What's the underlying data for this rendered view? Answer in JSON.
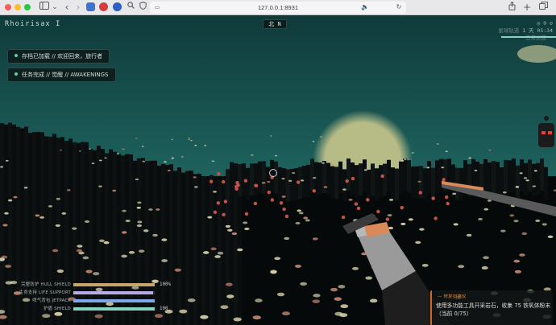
{
  "browser": {
    "url": "127.0.0.1:8931",
    "icons": [
      "sidebar-icon",
      "chevron-down-icon",
      "back-icon",
      "forward-icon",
      "search-icon",
      "shield-icon",
      "text-size-icon",
      "audio-icon",
      "reload-icon",
      "share-icon",
      "new-tab-icon",
      "tab-overview-icon"
    ]
  },
  "hud": {
    "player_name": "Rhoirisax I",
    "compass": "北 N",
    "stats_line1": "◎ 0 ⊙",
    "stats_line2_label": "星球轨道",
    "stats_line2_value": "1 天 05:34",
    "stats_line3": "任务进度 ·"
  },
  "notifications": [
    {
      "text": "存档已加载 // 欢迎回来，旅行者"
    },
    {
      "text": "任务完成 // 觉醒 // AWAKENINGS"
    }
  ],
  "status_bars": [
    {
      "label": "完整防护 HULL SHIELD",
      "value": "100%",
      "fill": 1.0,
      "color": "#c9a56b"
    },
    {
      "label": "生命支持 LIFE SUPPORT",
      "value": "",
      "fill": 0.98,
      "color": "#b9a9e6"
    },
    {
      "label": "喷气背包 JETPACK",
      "value": "",
      "fill": 1.0,
      "color": "#7ea6ea"
    },
    {
      "label": "护盾 SHIELD",
      "value": "100",
      "fill": 1.0,
      "color": "#86d3c2"
    }
  ],
  "mission": {
    "header": "— 修复扫描仪",
    "body": "使用多功能工具开采岩石，收集 75 铁氧体粉末（当前 0/75）"
  },
  "colors": {
    "sky_top": "#0f3a3a",
    "sky_bottom": "#2c8074",
    "sun": "#b7bb86",
    "accent_mission": "#c96a2a",
    "notif_dot": "#5fd39a"
  }
}
